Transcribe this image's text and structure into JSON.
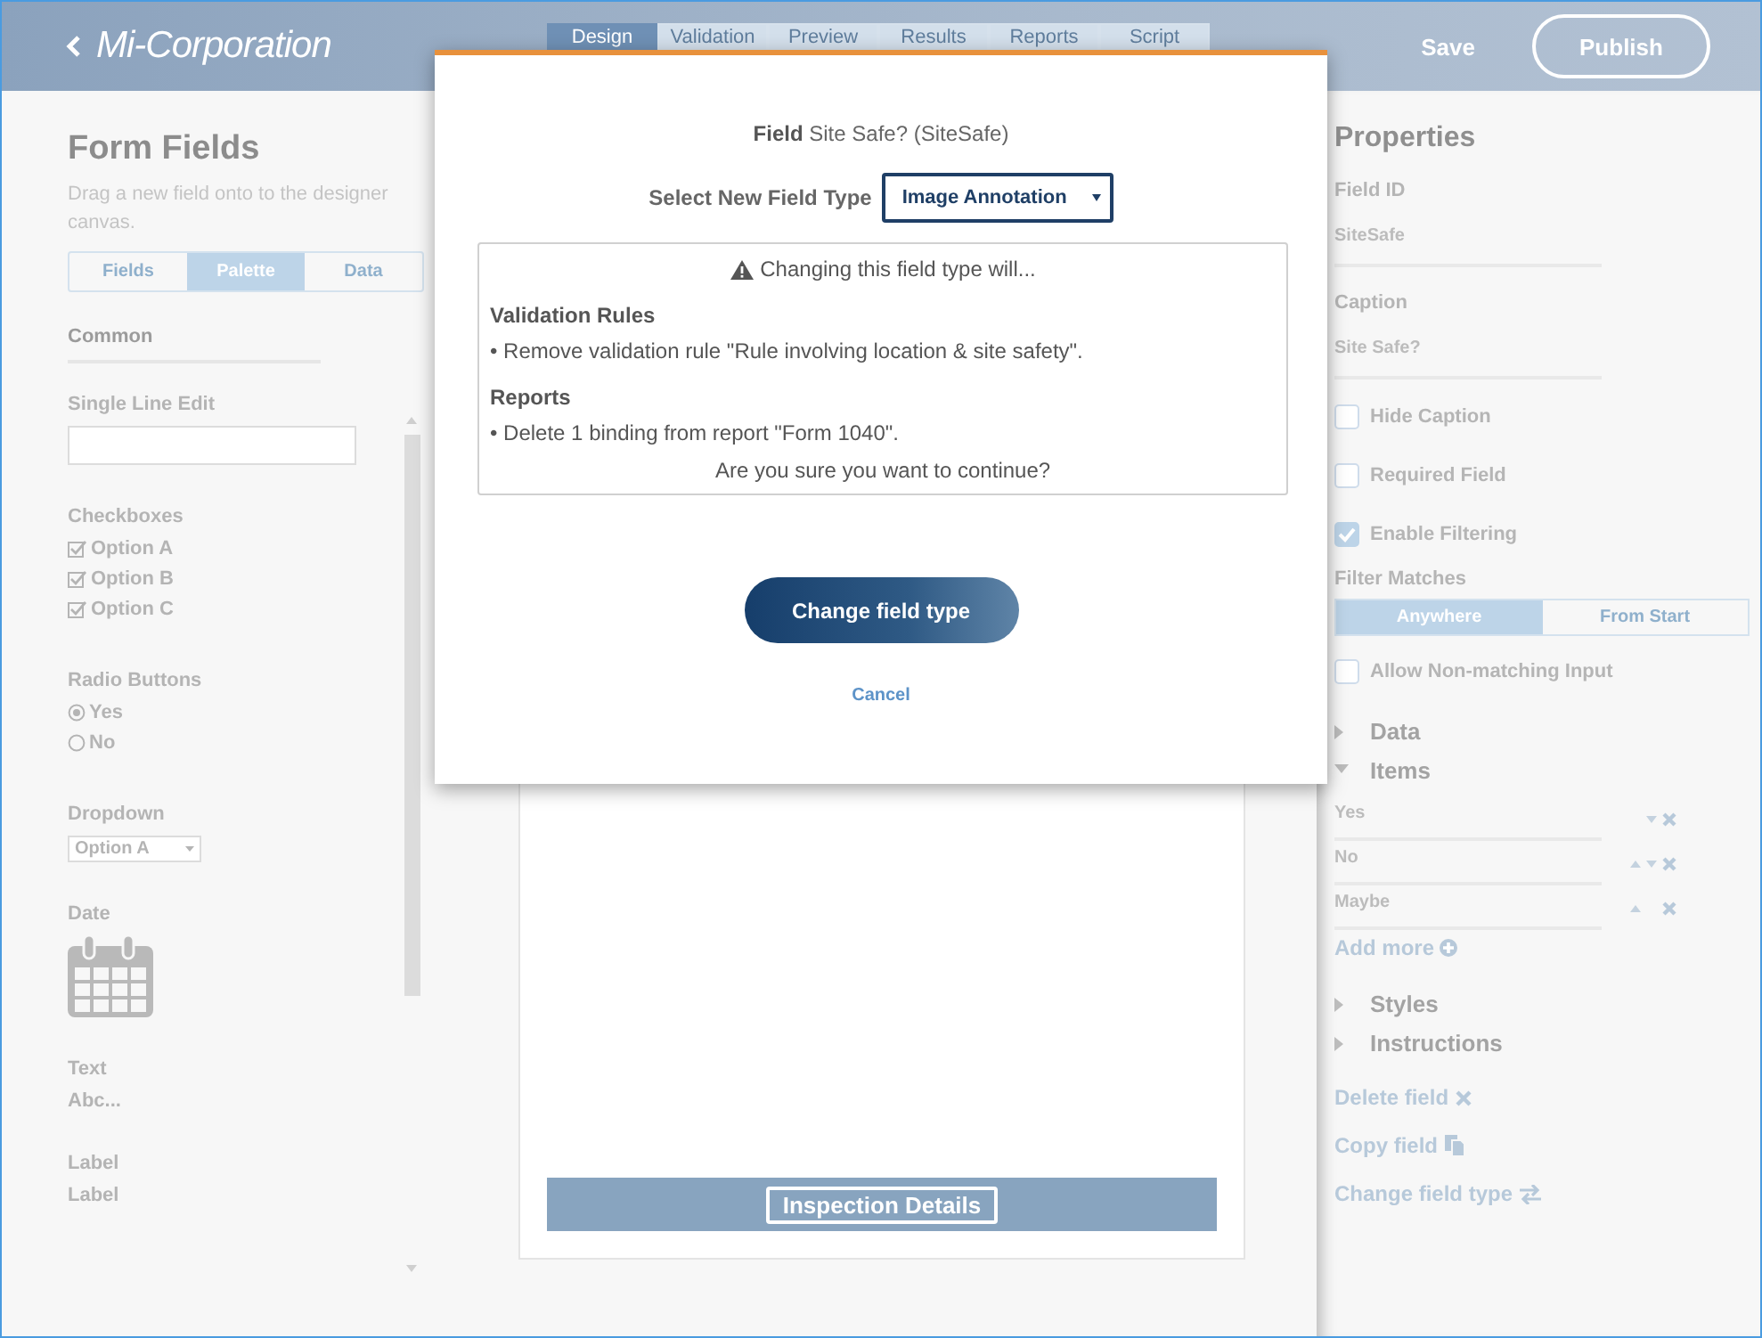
{
  "header": {
    "brand": "Mi-Corporation",
    "tabs": [
      {
        "label": "Design",
        "selected": true
      },
      {
        "label": "Validation",
        "selected": false
      },
      {
        "label": "Preview",
        "selected": false
      },
      {
        "label": "Results",
        "selected": false
      },
      {
        "label": "Reports",
        "selected": false
      },
      {
        "label": "Script",
        "selected": false
      }
    ],
    "save": "Save",
    "publish": "Publish"
  },
  "form_fields": {
    "title": "Form Fields",
    "hint": "Drag a new field onto to the designer canvas.",
    "tabs": [
      {
        "label": "Fields",
        "selected": false
      },
      {
        "label": "Palette",
        "selected": true
      },
      {
        "label": "Data",
        "selected": false
      }
    ],
    "palette": [
      {
        "kind": "heading",
        "label": "Common"
      },
      {
        "kind": "textbox",
        "label": "Single Line Edit"
      },
      {
        "kind": "checkboxes",
        "label": "Checkboxes",
        "options": [
          {
            "label": "Option A",
            "checked": true
          },
          {
            "label": "Option B",
            "checked": true
          },
          {
            "label": "Option C",
            "checked": true
          }
        ]
      },
      {
        "kind": "radios",
        "label": "Radio Buttons",
        "options": [
          {
            "label": "Yes",
            "selected": true
          },
          {
            "label": "No",
            "selected": false
          }
        ]
      },
      {
        "kind": "dropdown",
        "label": "Dropdown",
        "value": "Option A"
      },
      {
        "kind": "date",
        "label": "Date"
      },
      {
        "kind": "sample",
        "label": "Text",
        "sample": "Abc..."
      },
      {
        "kind": "sample",
        "label": "Label",
        "sample": "Label"
      }
    ]
  },
  "canvas": {
    "section_title": "Inspection Details"
  },
  "properties": {
    "title": "Properties",
    "fields": [
      {
        "label": "Field ID",
        "value": "SiteSafe"
      },
      {
        "label": "Caption",
        "value": "Site Safe?"
      }
    ],
    "options": [
      {
        "label": "Hide Caption",
        "checked": false
      },
      {
        "label": "Required Field",
        "checked": false
      },
      {
        "label": "Enable Filtering",
        "checked": true
      }
    ],
    "filter_matches": {
      "label": "Filter Matches",
      "choices": [
        {
          "label": "Anywhere",
          "selected": true
        },
        {
          "label": "From Start",
          "selected": false
        }
      ]
    },
    "allow_non_matching": {
      "label": "Allow Non-matching Input",
      "checked": false
    },
    "sections": [
      {
        "label": "Data",
        "expanded": false
      },
      {
        "label": "Items",
        "expanded": true,
        "items": [
          {
            "label": "Yes",
            "can_move_up": false,
            "can_move_down": true
          },
          {
            "label": "No",
            "can_move_up": true,
            "can_move_down": true
          },
          {
            "label": "Maybe",
            "can_move_up": true,
            "can_move_down": false
          }
        ],
        "add_more": "Add more"
      },
      {
        "label": "Styles",
        "expanded": false
      },
      {
        "label": "Instructions",
        "expanded": false
      }
    ],
    "actions": [
      {
        "kind": "delete",
        "label": "Delete field"
      },
      {
        "kind": "copy",
        "label": "Copy field"
      },
      {
        "kind": "change",
        "label": "Change field type"
      }
    ]
  },
  "dialog": {
    "field": "**Field** Site Safe? (SiteSafe)",
    "type_label": "Select New Field Type",
    "type_value": "Image Annotation",
    "warning": "Changing this field type will...",
    "groups": [
      {
        "title": "Validation Rules",
        "items": [
          "• Remove validation rule \"Rule involving location & site safety\"."
        ]
      },
      {
        "title": "Reports",
        "items": [
          "• Delete 1 binding from report \"Form 1040\"."
        ]
      }
    ],
    "question": "Are you sure you want to continue?",
    "confirm": "Change field type",
    "cancel": "Cancel"
  }
}
